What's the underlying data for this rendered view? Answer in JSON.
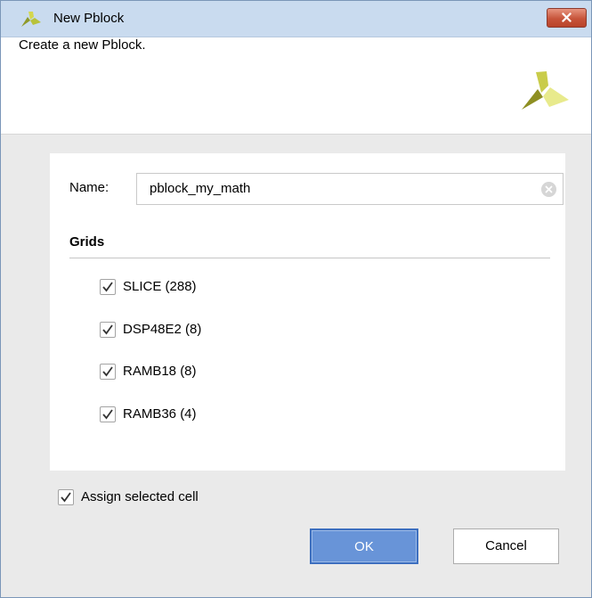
{
  "window": {
    "title": "New Pblock",
    "close_icon": "close-icon"
  },
  "header": {
    "text": "Create a new Pblock.",
    "logo_icon": "vivado-logo-icon"
  },
  "form": {
    "name_label": "Name:",
    "name_value": "pblock_my_math",
    "grids_label": "Grids",
    "grids": [
      {
        "label": "SLICE (288)",
        "checked": true
      },
      {
        "label": "DSP48E2 (8)",
        "checked": true
      },
      {
        "label": "RAMB18 (8)",
        "checked": true
      },
      {
        "label": "RAMB36 (4)",
        "checked": true
      }
    ],
    "assign_label": "Assign selected cell",
    "assign_checked": true
  },
  "buttons": {
    "ok": "OK",
    "cancel": "Cancel"
  },
  "colors": {
    "titlebar": "#c9dbef",
    "ok_button": "#6894d8",
    "logo_dark": "#9a9b2c",
    "logo_light": "#e8ea8c"
  }
}
